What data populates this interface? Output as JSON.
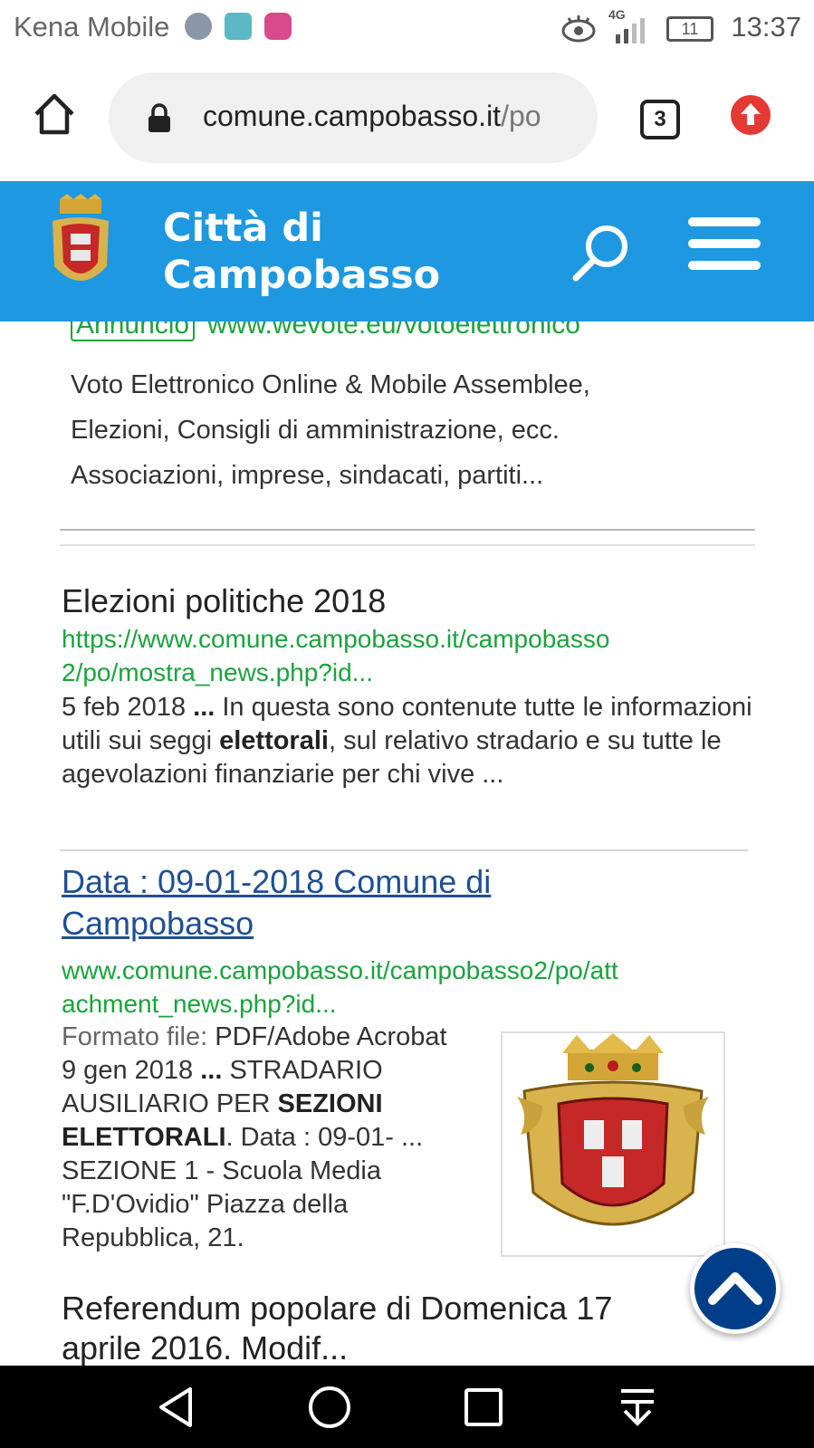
{
  "status_bar": {
    "carrier": "Kena Mobile",
    "network": "4G",
    "battery": "11",
    "time": "13:37"
  },
  "browser": {
    "url_host": "comune.campobasso.it",
    "url_path": "/po",
    "tab_count": "3"
  },
  "site": {
    "title_line1": "Città di",
    "title_line2": "Campobasso"
  },
  "ad": {
    "badge": "Annuncio",
    "url": "www.wevote.eu/votoelettronico",
    "lines": [
      "Voto Elettronico Online & Mobile Assemblee,",
      "Elezioni, Consigli di amministrazione, ecc.",
      "Associazioni, imprese, sindacati, partiti..."
    ]
  },
  "results": [
    {
      "title": "Elezioni politiche 2018",
      "url_lines": [
        "https://www.comune.campobasso.it/campobasso",
        "2/po/mostra_news.php?id..."
      ],
      "date": "5 feb 2018",
      "ellipsis": "...",
      "text_a": " In questa sono contenute tutte le informazioni utili sui seggi ",
      "bold": "elettorali",
      "text_b": ", sul relativo stradario e su tutte le agevolazioni finanziarie per chi vive ..."
    },
    {
      "title_line1": "Data : 09-01-2018 Comune di",
      "title_line2": "Campobasso",
      "url_lines": [
        "www.comune.campobasso.it/campobasso2/po/att",
        "achment_news.php?id..."
      ],
      "format_label": "Formato file:",
      "format_value": " PDF/Adobe Acrobat",
      "date": "9 gen 2018",
      "ellipsis": "...",
      "text_a": " STRADARIO AUSILIARIO PER ",
      "bold": "SEZIONI ELETTORALI",
      "text_b": ". Data : 09-01- ... SEZIONE 1 - Scuola Media \"F.D'Ovidio\" Piazza della Repubblica, 21."
    },
    {
      "title": "Referendum popolare di Domenica 17",
      "title_cut": "aprile 2016. Modif..."
    }
  ],
  "icons": {
    "home": "home-icon",
    "lock": "lock-icon",
    "update": "arrow-up-icon",
    "search": "search-icon",
    "menu": "hamburger-menu-icon",
    "back_to_top": "chevron-up-icon"
  },
  "colors": {
    "header_blue": "#1e98e0",
    "link_green": "#1aa33c",
    "link_blue": "#1f4f95",
    "fab_blue": "#003e8a"
  }
}
